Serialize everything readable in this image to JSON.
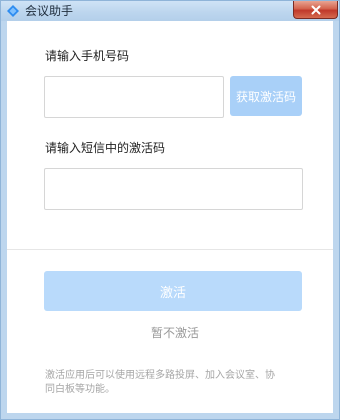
{
  "window": {
    "title": "会议助手",
    "icon": "blue-diamond-icon",
    "close_icon": "close-icon"
  },
  "phone": {
    "label": "请输入手机号码",
    "value": "",
    "placeholder": ""
  },
  "get_code": {
    "label": "获取激活码"
  },
  "sms": {
    "label": "请输入短信中的激活码",
    "value": "",
    "placeholder": ""
  },
  "activate": {
    "label": "激活"
  },
  "skip": {
    "label": "暂不激活"
  },
  "footnote": {
    "line1": "激活应用后可以使用远程多路投屏、加入会议室、协",
    "line2": "同白板等功能。"
  },
  "colors": {
    "accent_disabled": "#b9dafb",
    "titlebar": "#bdd6ee",
    "close": "#c0392b"
  }
}
